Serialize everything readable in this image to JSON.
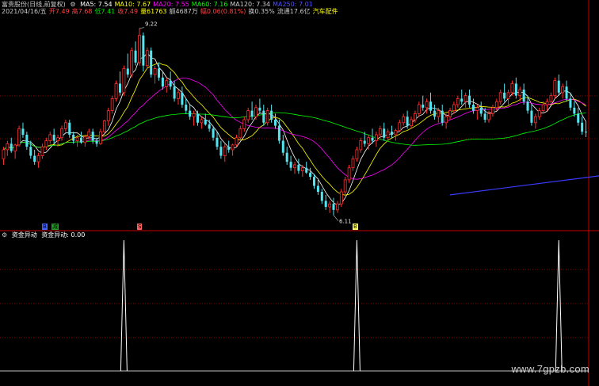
{
  "header": {
    "title": "富贵股份(日线,前复权)",
    "ma_items": [
      {
        "label": "MA5: 7.54",
        "color": "#ffffff"
      },
      {
        "label": "MA10: 7.67",
        "color": "#ffff00"
      },
      {
        "label": "MA20: 7.55",
        "color": "#ff00ff"
      },
      {
        "label": "MA60: 7.16",
        "color": "#00ff00"
      },
      {
        "label": "MA120: 7.34",
        "color": "#cfcfcf"
      },
      {
        "label": "MA250: 7.01",
        "color": "#5050ff"
      }
    ],
    "info_items": [
      {
        "label": "2021/04/16/五",
        "color": "#c8c8c8"
      },
      {
        "label": "开7.49",
        "color": "#ff4040"
      },
      {
        "label": "高7.68",
        "color": "#ff4040"
      },
      {
        "label": "低7.41",
        "color": "#00e000"
      },
      {
        "label": "收7.49",
        "color": "#ff4040"
      },
      {
        "label": "量61763",
        "color": "#ffff00"
      },
      {
        "label": "额4687万",
        "color": "#c8c8c8"
      },
      {
        "label": "幅0.06(0.81%)",
        "color": "#ff4040"
      },
      {
        "label": "换0.35%",
        "color": "#c8c8c8"
      },
      {
        "label": "流通17.6亿",
        "color": "#c8c8c8"
      },
      {
        "label": "汽车配件",
        "color": "#ffff00"
      }
    ]
  },
  "annotations": {
    "high_label": "9.22",
    "low_label": "6.11"
  },
  "markers": [
    {
      "label": "B",
      "bg": "#4060ff"
    },
    {
      "label": "减",
      "bg": "#20a020"
    },
    {
      "label": "S",
      "bg": "#ff6060"
    },
    {
      "label": "B",
      "bg": "#ffff60"
    }
  ],
  "sub_panel": {
    "title": "资金异动",
    "value_label": "资金异动: 0.00",
    "spikes": [
      {
        "candle_index": 31,
        "value": 1
      },
      {
        "candle_index": 91,
        "value": 1
      },
      {
        "candle_index": 143,
        "value": 1
      }
    ]
  },
  "colors": {
    "up": "#ff3030",
    "down": "#54e4f0",
    "ma5": "#ffffff",
    "ma10": "#ffff00",
    "ma20": "#ff00ff",
    "ma60": "#00ff00",
    "ma250": "#3a3aff",
    "grid": "#8b0000",
    "divider": "#c80000"
  },
  "chart_data": {
    "type": "candlestick",
    "y_range": [
      6.0,
      9.4
    ],
    "ohlc": [
      [
        7.05,
        7.25,
        6.95,
        7.2
      ],
      [
        7.2,
        7.35,
        7.1,
        7.3
      ],
      [
        7.3,
        7.4,
        7.15,
        7.18
      ],
      [
        7.18,
        7.3,
        7.05,
        7.28
      ],
      [
        7.28,
        7.6,
        7.25,
        7.55
      ],
      [
        7.55,
        7.65,
        7.4,
        7.45
      ],
      [
        7.45,
        7.5,
        7.2,
        7.25
      ],
      [
        7.25,
        7.35,
        7.05,
        7.1
      ],
      [
        7.1,
        7.2,
        6.95,
        7.0
      ],
      [
        7.0,
        7.15,
        6.9,
        7.1
      ],
      [
        7.1,
        7.3,
        7.05,
        7.25
      ],
      [
        7.25,
        7.4,
        7.2,
        7.35
      ],
      [
        7.35,
        7.5,
        7.3,
        7.45
      ],
      [
        7.45,
        7.55,
        7.3,
        7.35
      ],
      [
        7.35,
        7.45,
        7.25,
        7.4
      ],
      [
        7.4,
        7.6,
        7.35,
        7.55
      ],
      [
        7.55,
        7.7,
        7.5,
        7.65
      ],
      [
        7.65,
        7.7,
        7.4,
        7.45
      ],
      [
        7.45,
        7.5,
        7.3,
        7.35
      ],
      [
        7.35,
        7.45,
        7.25,
        7.4
      ],
      [
        7.4,
        7.5,
        7.3,
        7.32
      ],
      [
        7.32,
        7.45,
        7.25,
        7.42
      ],
      [
        7.42,
        7.55,
        7.38,
        7.5
      ],
      [
        7.5,
        7.55,
        7.3,
        7.35
      ],
      [
        7.35,
        7.4,
        7.25,
        7.3
      ],
      [
        7.3,
        7.55,
        7.28,
        7.5
      ],
      [
        7.5,
        7.7,
        7.48,
        7.68
      ],
      [
        7.68,
        7.9,
        7.6,
        7.85
      ],
      [
        7.85,
        8.1,
        7.8,
        8.05
      ],
      [
        8.05,
        8.35,
        8.0,
        8.3
      ],
      [
        8.3,
        8.5,
        8.1,
        8.15
      ],
      [
        8.15,
        8.6,
        8.1,
        8.55
      ],
      [
        8.55,
        8.8,
        8.4,
        8.45
      ],
      [
        8.45,
        8.9,
        8.4,
        8.85
      ],
      [
        8.85,
        9.0,
        8.6,
        8.65
      ],
      [
        8.65,
        9.22,
        8.6,
        9.1
      ],
      [
        9.1,
        9.15,
        8.5,
        8.6
      ],
      [
        8.6,
        8.9,
        8.55,
        8.85
      ],
      [
        8.85,
        8.9,
        8.4,
        8.45
      ],
      [
        8.45,
        8.6,
        8.3,
        8.55
      ],
      [
        8.55,
        8.65,
        8.35,
        8.4
      ],
      [
        8.4,
        8.5,
        8.2,
        8.25
      ],
      [
        8.25,
        8.4,
        8.15,
        8.35
      ],
      [
        8.35,
        8.5,
        8.2,
        8.25
      ],
      [
        8.25,
        8.35,
        8.0,
        8.05
      ],
      [
        8.05,
        8.2,
        7.95,
        8.15
      ],
      [
        8.15,
        8.25,
        7.9,
        7.95
      ],
      [
        7.95,
        8.05,
        7.8,
        7.85
      ],
      [
        7.85,
        7.95,
        7.7,
        7.75
      ],
      [
        7.75,
        7.85,
        7.6,
        7.8
      ],
      [
        7.8,
        7.85,
        7.6,
        7.65
      ],
      [
        7.65,
        7.75,
        7.55,
        7.7
      ],
      [
        7.7,
        7.8,
        7.6,
        7.62
      ],
      [
        7.62,
        7.7,
        7.5,
        7.55
      ],
      [
        7.55,
        7.6,
        7.35,
        7.4
      ],
      [
        7.4,
        7.5,
        7.2,
        7.25
      ],
      [
        7.25,
        7.35,
        7.05,
        7.1
      ],
      [
        7.1,
        7.3,
        7.0,
        7.25
      ],
      [
        7.25,
        7.35,
        7.15,
        7.2
      ],
      [
        7.2,
        7.3,
        7.1,
        7.28
      ],
      [
        7.28,
        7.45,
        7.25,
        7.4
      ],
      [
        7.4,
        7.6,
        7.35,
        7.55
      ],
      [
        7.55,
        7.75,
        7.5,
        7.7
      ],
      [
        7.7,
        7.9,
        7.65,
        7.85
      ],
      [
        7.85,
        8.0,
        7.7,
        7.75
      ],
      [
        7.75,
        7.95,
        7.7,
        7.9
      ],
      [
        7.9,
        8.05,
        7.8,
        7.85
      ],
      [
        7.85,
        7.95,
        7.6,
        7.65
      ],
      [
        7.65,
        7.9,
        7.6,
        7.85
      ],
      [
        7.85,
        7.95,
        7.65,
        7.7
      ],
      [
        7.7,
        7.8,
        7.55,
        7.6
      ],
      [
        7.6,
        7.7,
        7.3,
        7.35
      ],
      [
        7.35,
        7.45,
        7.1,
        7.15
      ],
      [
        7.15,
        7.25,
        6.95,
        7.0
      ],
      [
        7.0,
        7.1,
        6.85,
        6.9
      ],
      [
        6.9,
        7.0,
        6.8,
        6.95
      ],
      [
        6.95,
        7.05,
        6.8,
        6.85
      ],
      [
        6.85,
        6.95,
        6.75,
        6.9
      ],
      [
        6.9,
        7.0,
        6.8,
        6.82
      ],
      [
        6.82,
        6.9,
        6.7,
        6.75
      ],
      [
        6.75,
        6.8,
        6.55,
        6.6
      ],
      [
        6.6,
        6.7,
        6.45,
        6.5
      ],
      [
        6.5,
        6.55,
        6.3,
        6.35
      ],
      [
        6.35,
        6.45,
        6.2,
        6.25
      ],
      [
        6.25,
        6.35,
        6.15,
        6.3
      ],
      [
        6.3,
        6.4,
        6.11,
        6.2
      ],
      [
        6.2,
        6.35,
        6.15,
        6.3
      ],
      [
        6.3,
        6.55,
        6.25,
        6.5
      ],
      [
        6.5,
        6.75,
        6.45,
        6.7
      ],
      [
        6.7,
        6.95,
        6.65,
        6.9
      ],
      [
        6.9,
        7.1,
        6.85,
        7.05
      ],
      [
        7.05,
        7.25,
        7.0,
        7.2
      ],
      [
        7.2,
        7.4,
        7.15,
        7.35
      ],
      [
        7.35,
        7.5,
        7.25,
        7.3
      ],
      [
        7.3,
        7.45,
        7.2,
        7.4
      ],
      [
        7.4,
        7.55,
        7.3,
        7.35
      ],
      [
        7.35,
        7.5,
        7.25,
        7.45
      ],
      [
        7.45,
        7.6,
        7.4,
        7.55
      ],
      [
        7.55,
        7.65,
        7.35,
        7.4
      ],
      [
        7.4,
        7.55,
        7.35,
        7.5
      ],
      [
        7.5,
        7.6,
        7.4,
        7.45
      ],
      [
        7.45,
        7.55,
        7.35,
        7.52
      ],
      [
        7.52,
        7.7,
        7.5,
        7.65
      ],
      [
        7.65,
        7.8,
        7.6,
        7.75
      ],
      [
        7.75,
        7.85,
        7.55,
        7.6
      ],
      [
        7.6,
        7.75,
        7.55,
        7.7
      ],
      [
        7.7,
        7.85,
        7.65,
        7.8
      ],
      [
        7.8,
        8.0,
        7.75,
        7.95
      ],
      [
        7.95,
        8.1,
        7.85,
        7.9
      ],
      [
        7.9,
        8.05,
        7.8,
        8.0
      ],
      [
        8.0,
        8.15,
        7.8,
        7.85
      ],
      [
        7.85,
        7.95,
        7.7,
        7.75
      ],
      [
        7.75,
        7.9,
        7.65,
        7.85
      ],
      [
        7.85,
        7.95,
        7.6,
        7.65
      ],
      [
        7.65,
        7.8,
        7.55,
        7.75
      ],
      [
        7.75,
        7.9,
        7.7,
        7.85
      ],
      [
        7.85,
        8.0,
        7.8,
        7.95
      ],
      [
        7.95,
        8.1,
        7.9,
        8.05
      ],
      [
        8.05,
        8.2,
        7.95,
        8.0
      ],
      [
        8.0,
        8.15,
        7.9,
        8.1
      ],
      [
        8.1,
        8.2,
        7.9,
        7.95
      ],
      [
        7.95,
        8.05,
        7.8,
        7.85
      ],
      [
        7.85,
        7.95,
        7.7,
        7.9
      ],
      [
        7.9,
        8.0,
        7.75,
        7.8
      ],
      [
        7.8,
        7.9,
        7.65,
        7.7
      ],
      [
        7.7,
        7.85,
        7.65,
        7.8
      ],
      [
        7.8,
        7.95,
        7.75,
        7.9
      ],
      [
        7.9,
        8.05,
        7.85,
        8.0
      ],
      [
        8.0,
        8.2,
        7.95,
        8.15
      ],
      [
        8.15,
        8.3,
        8.0,
        8.05
      ],
      [
        8.05,
        8.2,
        7.95,
        8.15
      ],
      [
        8.15,
        8.35,
        8.1,
        8.3
      ],
      [
        8.3,
        8.4,
        8.05,
        8.1
      ],
      [
        8.1,
        8.25,
        8.0,
        8.2
      ],
      [
        8.2,
        8.3,
        7.95,
        8.0
      ],
      [
        8.0,
        8.1,
        7.8,
        7.85
      ],
      [
        7.85,
        7.95,
        7.6,
        7.65
      ],
      [
        7.65,
        7.8,
        7.55,
        7.75
      ],
      [
        7.75,
        7.9,
        7.7,
        7.85
      ],
      [
        7.85,
        8.0,
        7.8,
        7.95
      ],
      [
        7.95,
        8.05,
        7.85,
        8.0
      ],
      [
        8.0,
        8.15,
        7.95,
        8.1
      ],
      [
        8.1,
        8.4,
        8.05,
        8.35
      ],
      [
        8.35,
        8.45,
        8.1,
        8.15
      ],
      [
        8.15,
        8.3,
        8.05,
        8.25
      ],
      [
        8.25,
        8.35,
        8.0,
        8.05
      ],
      [
        8.05,
        8.15,
        7.85,
        7.9
      ],
      [
        7.9,
        8.0,
        7.75,
        7.8
      ],
      [
        7.8,
        7.9,
        7.6,
        7.65
      ],
      [
        7.65,
        7.75,
        7.45,
        7.5
      ],
      [
        7.5,
        7.68,
        7.41,
        7.49
      ]
    ]
  }
}
